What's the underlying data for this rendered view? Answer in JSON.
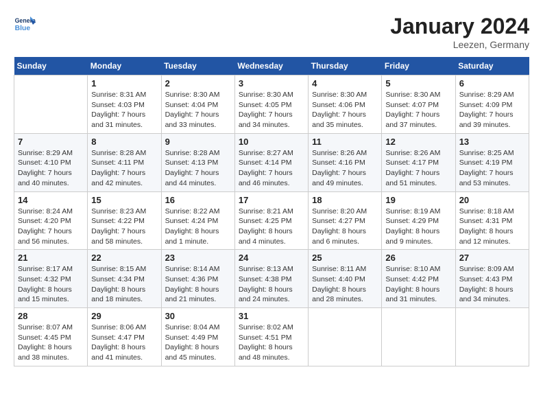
{
  "header": {
    "logo_line1": "General",
    "logo_line2": "Blue",
    "month_title": "January 2024",
    "location": "Leezen, Germany"
  },
  "days_of_week": [
    "Sunday",
    "Monday",
    "Tuesday",
    "Wednesday",
    "Thursday",
    "Friday",
    "Saturday"
  ],
  "weeks": [
    [
      {
        "day": "",
        "sunrise": "",
        "sunset": "",
        "daylight": ""
      },
      {
        "day": "1",
        "sunrise": "Sunrise: 8:31 AM",
        "sunset": "Sunset: 4:03 PM",
        "daylight": "Daylight: 7 hours and 31 minutes."
      },
      {
        "day": "2",
        "sunrise": "Sunrise: 8:30 AM",
        "sunset": "Sunset: 4:04 PM",
        "daylight": "Daylight: 7 hours and 33 minutes."
      },
      {
        "day": "3",
        "sunrise": "Sunrise: 8:30 AM",
        "sunset": "Sunset: 4:05 PM",
        "daylight": "Daylight: 7 hours and 34 minutes."
      },
      {
        "day": "4",
        "sunrise": "Sunrise: 8:30 AM",
        "sunset": "Sunset: 4:06 PM",
        "daylight": "Daylight: 7 hours and 35 minutes."
      },
      {
        "day": "5",
        "sunrise": "Sunrise: 8:30 AM",
        "sunset": "Sunset: 4:07 PM",
        "daylight": "Daylight: 7 hours and 37 minutes."
      },
      {
        "day": "6",
        "sunrise": "Sunrise: 8:29 AM",
        "sunset": "Sunset: 4:09 PM",
        "daylight": "Daylight: 7 hours and 39 minutes."
      }
    ],
    [
      {
        "day": "7",
        "sunrise": "Sunrise: 8:29 AM",
        "sunset": "Sunset: 4:10 PM",
        "daylight": "Daylight: 7 hours and 40 minutes."
      },
      {
        "day": "8",
        "sunrise": "Sunrise: 8:28 AM",
        "sunset": "Sunset: 4:11 PM",
        "daylight": "Daylight: 7 hours and 42 minutes."
      },
      {
        "day": "9",
        "sunrise": "Sunrise: 8:28 AM",
        "sunset": "Sunset: 4:13 PM",
        "daylight": "Daylight: 7 hours and 44 minutes."
      },
      {
        "day": "10",
        "sunrise": "Sunrise: 8:27 AM",
        "sunset": "Sunset: 4:14 PM",
        "daylight": "Daylight: 7 hours and 46 minutes."
      },
      {
        "day": "11",
        "sunrise": "Sunrise: 8:26 AM",
        "sunset": "Sunset: 4:16 PM",
        "daylight": "Daylight: 7 hours and 49 minutes."
      },
      {
        "day": "12",
        "sunrise": "Sunrise: 8:26 AM",
        "sunset": "Sunset: 4:17 PM",
        "daylight": "Daylight: 7 hours and 51 minutes."
      },
      {
        "day": "13",
        "sunrise": "Sunrise: 8:25 AM",
        "sunset": "Sunset: 4:19 PM",
        "daylight": "Daylight: 7 hours and 53 minutes."
      }
    ],
    [
      {
        "day": "14",
        "sunrise": "Sunrise: 8:24 AM",
        "sunset": "Sunset: 4:20 PM",
        "daylight": "Daylight: 7 hours and 56 minutes."
      },
      {
        "day": "15",
        "sunrise": "Sunrise: 8:23 AM",
        "sunset": "Sunset: 4:22 PM",
        "daylight": "Daylight: 7 hours and 58 minutes."
      },
      {
        "day": "16",
        "sunrise": "Sunrise: 8:22 AM",
        "sunset": "Sunset: 4:24 PM",
        "daylight": "Daylight: 8 hours and 1 minute."
      },
      {
        "day": "17",
        "sunrise": "Sunrise: 8:21 AM",
        "sunset": "Sunset: 4:25 PM",
        "daylight": "Daylight: 8 hours and 4 minutes."
      },
      {
        "day": "18",
        "sunrise": "Sunrise: 8:20 AM",
        "sunset": "Sunset: 4:27 PM",
        "daylight": "Daylight: 8 hours and 6 minutes."
      },
      {
        "day": "19",
        "sunrise": "Sunrise: 8:19 AM",
        "sunset": "Sunset: 4:29 PM",
        "daylight": "Daylight: 8 hours and 9 minutes."
      },
      {
        "day": "20",
        "sunrise": "Sunrise: 8:18 AM",
        "sunset": "Sunset: 4:31 PM",
        "daylight": "Daylight: 8 hours and 12 minutes."
      }
    ],
    [
      {
        "day": "21",
        "sunrise": "Sunrise: 8:17 AM",
        "sunset": "Sunset: 4:32 PM",
        "daylight": "Daylight: 8 hours and 15 minutes."
      },
      {
        "day": "22",
        "sunrise": "Sunrise: 8:15 AM",
        "sunset": "Sunset: 4:34 PM",
        "daylight": "Daylight: 8 hours and 18 minutes."
      },
      {
        "day": "23",
        "sunrise": "Sunrise: 8:14 AM",
        "sunset": "Sunset: 4:36 PM",
        "daylight": "Daylight: 8 hours and 21 minutes."
      },
      {
        "day": "24",
        "sunrise": "Sunrise: 8:13 AM",
        "sunset": "Sunset: 4:38 PM",
        "daylight": "Daylight: 8 hours and 24 minutes."
      },
      {
        "day": "25",
        "sunrise": "Sunrise: 8:11 AM",
        "sunset": "Sunset: 4:40 PM",
        "daylight": "Daylight: 8 hours and 28 minutes."
      },
      {
        "day": "26",
        "sunrise": "Sunrise: 8:10 AM",
        "sunset": "Sunset: 4:42 PM",
        "daylight": "Daylight: 8 hours and 31 minutes."
      },
      {
        "day": "27",
        "sunrise": "Sunrise: 8:09 AM",
        "sunset": "Sunset: 4:43 PM",
        "daylight": "Daylight: 8 hours and 34 minutes."
      }
    ],
    [
      {
        "day": "28",
        "sunrise": "Sunrise: 8:07 AM",
        "sunset": "Sunset: 4:45 PM",
        "daylight": "Daylight: 8 hours and 38 minutes."
      },
      {
        "day": "29",
        "sunrise": "Sunrise: 8:06 AM",
        "sunset": "Sunset: 4:47 PM",
        "daylight": "Daylight: 8 hours and 41 minutes."
      },
      {
        "day": "30",
        "sunrise": "Sunrise: 8:04 AM",
        "sunset": "Sunset: 4:49 PM",
        "daylight": "Daylight: 8 hours and 45 minutes."
      },
      {
        "day": "31",
        "sunrise": "Sunrise: 8:02 AM",
        "sunset": "Sunset: 4:51 PM",
        "daylight": "Daylight: 8 hours and 48 minutes."
      },
      {
        "day": "",
        "sunrise": "",
        "sunset": "",
        "daylight": ""
      },
      {
        "day": "",
        "sunrise": "",
        "sunset": "",
        "daylight": ""
      },
      {
        "day": "",
        "sunrise": "",
        "sunset": "",
        "daylight": ""
      }
    ]
  ]
}
